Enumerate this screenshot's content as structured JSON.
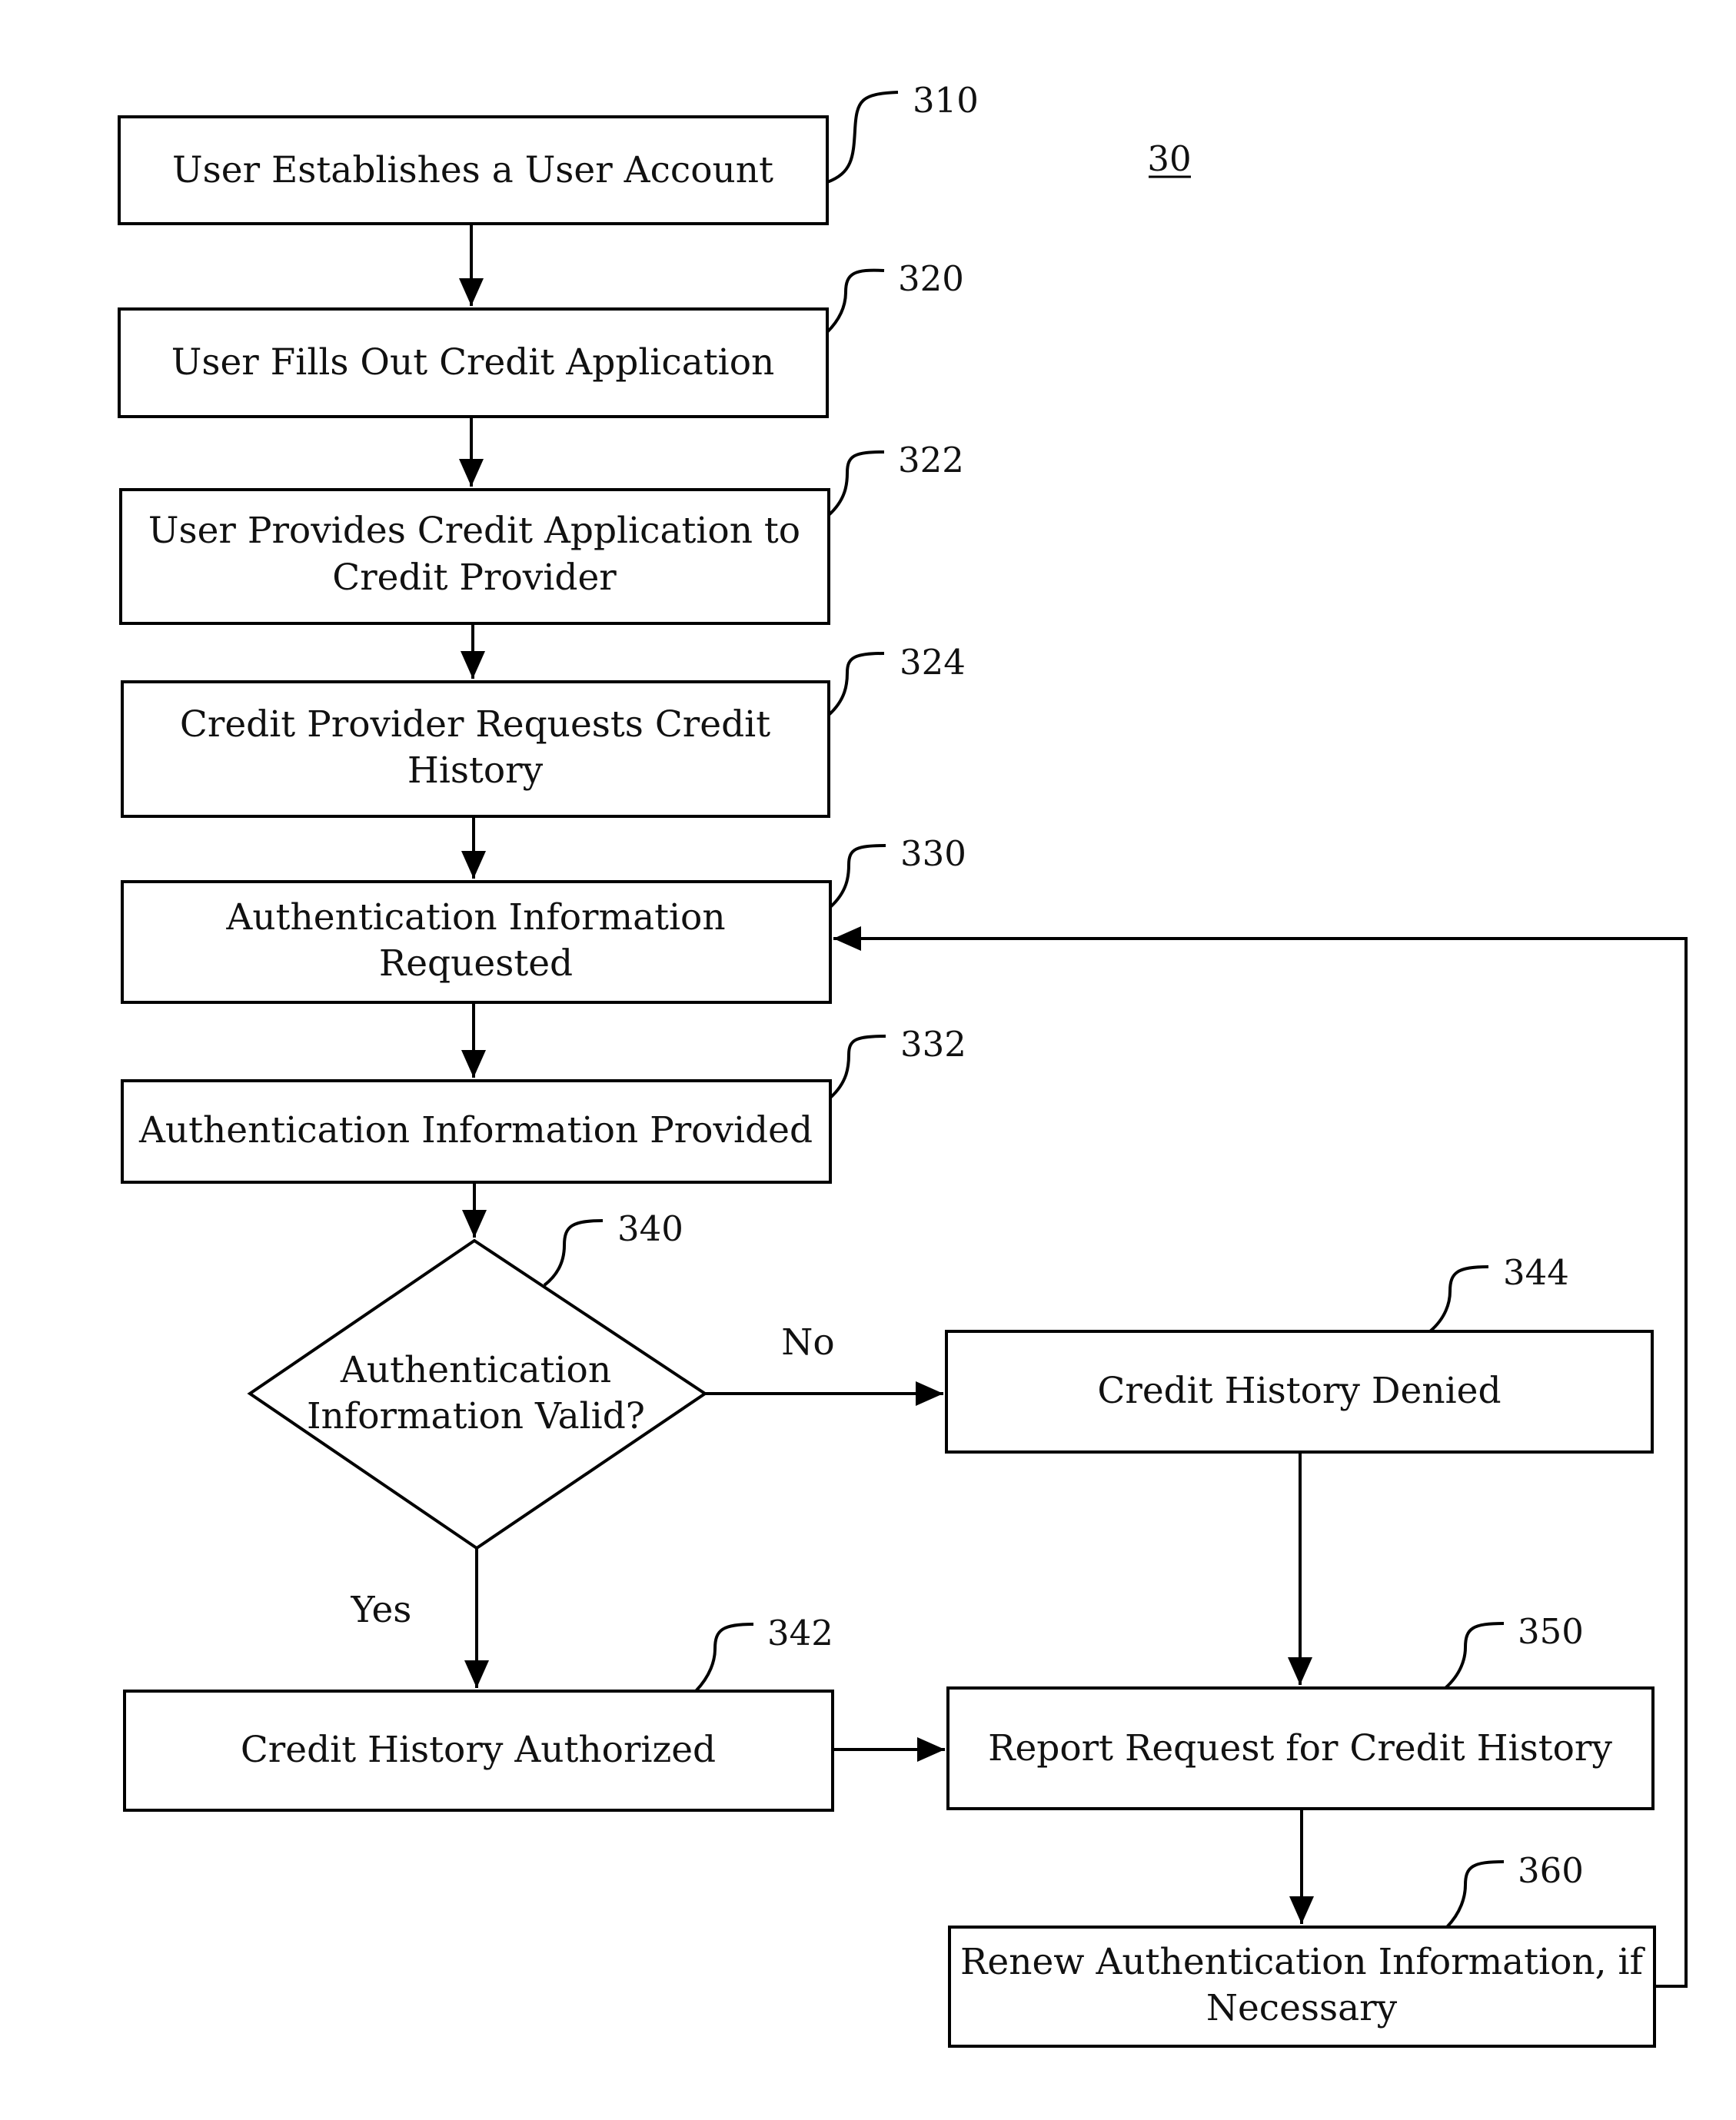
{
  "figure_label": "30",
  "steps": [
    {
      "ref": "310",
      "lines": [
        "User Establishes a User Account"
      ]
    },
    {
      "ref": "320",
      "lines": [
        "User Fills Out Credit Application"
      ]
    },
    {
      "ref": "322",
      "lines": [
        "User Provides Credit Application to",
        "Credit Provider"
      ]
    },
    {
      "ref": "324",
      "lines": [
        "Credit Provider Requests Credit",
        "History"
      ]
    },
    {
      "ref": "330",
      "lines": [
        "Authentication Information",
        "Requested"
      ]
    },
    {
      "ref": "332",
      "lines": [
        "Authentication Information Provided"
      ]
    },
    {
      "ref": "340",
      "lines": [
        "Authentication",
        "Information Valid?"
      ]
    },
    {
      "ref": "344",
      "lines": [
        "Credit History Denied"
      ]
    },
    {
      "ref": "342",
      "lines": [
        "Credit History Authorized"
      ]
    },
    {
      "ref": "350",
      "lines": [
        "Report Request for Credit History"
      ]
    },
    {
      "ref": "360",
      "lines": [
        "Renew Authentication Information, if",
        "Necessary"
      ]
    }
  ],
  "branches": {
    "no": "No",
    "yes": "Yes"
  }
}
